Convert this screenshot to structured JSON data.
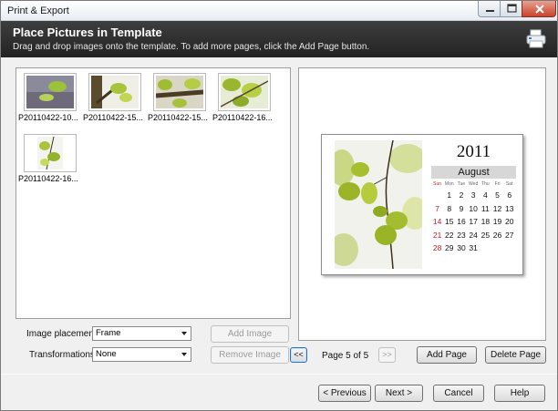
{
  "window": {
    "title": "Print & Export",
    "header_title": "Place Pictures in Template",
    "header_subtitle": "Drag and drop images onto the template. To add more pages, click the Add Page button."
  },
  "thumbnails": [
    {
      "caption": "P20110422-10..."
    },
    {
      "caption": "P20110422-15..."
    },
    {
      "caption": "P20110422-15..."
    },
    {
      "caption": "P20110422-16..."
    },
    {
      "caption": "P20110422-16..."
    }
  ],
  "calendar": {
    "year": "2011",
    "month": "August",
    "weekdays": [
      "Sun",
      "Mon",
      "Tue",
      "Wed",
      "Thu",
      "Fri",
      "Sat"
    ],
    "weeks": [
      [
        "",
        "1",
        "2",
        "3",
        "4",
        "5",
        "6"
      ],
      [
        "7",
        "8",
        "9",
        "10",
        "11",
        "12",
        "13"
      ],
      [
        "14",
        "15",
        "16",
        "17",
        "18",
        "19",
        "20"
      ],
      [
        "21",
        "22",
        "23",
        "24",
        "25",
        "26",
        "27"
      ],
      [
        "28",
        "29",
        "30",
        "31",
        "",
        "",
        ""
      ]
    ]
  },
  "controls": {
    "image_placement_label": "Image placement:",
    "image_placement_value": "Frame",
    "transformations_label": "Transformations:",
    "transformations_value": "None",
    "add_image": "Add Image",
    "remove_image": "Remove Image",
    "prev_page": "<<",
    "next_page": ">>",
    "page_info": "Page 5 of 5",
    "add_page": "Add Page",
    "delete_page": "Delete Page"
  },
  "footer": {
    "previous": "< Previous",
    "next": "Next >",
    "cancel": "Cancel",
    "help": "Help"
  },
  "icons": {
    "print": "printer-icon",
    "minimize": "minimize-icon",
    "maximize": "maximize-icon",
    "close": "close-icon"
  }
}
